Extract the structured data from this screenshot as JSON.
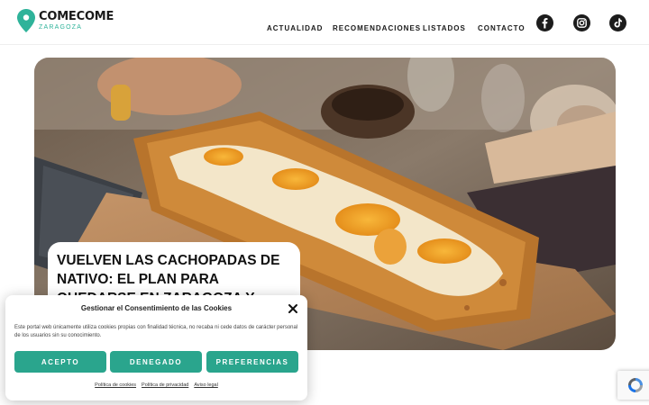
{
  "brand": {
    "name": "COMECOME",
    "city": "ZARAGOZA",
    "accent": "#2fb39a"
  },
  "nav": {
    "items": [
      "ACTUALIDAD",
      "RECOMENDACIONES",
      "LISTADOS",
      "CONTACTO"
    ]
  },
  "social": {
    "icons": [
      "facebook-icon",
      "instagram-icon",
      "tiktok-icon"
    ]
  },
  "hero": {
    "headline": "VUELVEN LAS CACHOPADAS DE NATIVO: EL PLAN PARA QUEDARSE EN ZARAGOZA Y VIAJAR IGUAL"
  },
  "consent": {
    "title": "Gestionar el Consentimiento de las Cookies",
    "text": "Este portal web únicamente utiliza cookies propias con finalidad técnica, no recaba ni cede datos de carácter personal de los usuarios sin su conocimiento.",
    "buttons": {
      "accept": "ACEPTO",
      "deny": "DENEGADO",
      "preferences": "PREFERENCIAS"
    },
    "button_color": "#2aa58d",
    "links": {
      "cookies": "Política de cookies",
      "privacy": "Política de privacidad",
      "legal": "Aviso legal"
    }
  }
}
